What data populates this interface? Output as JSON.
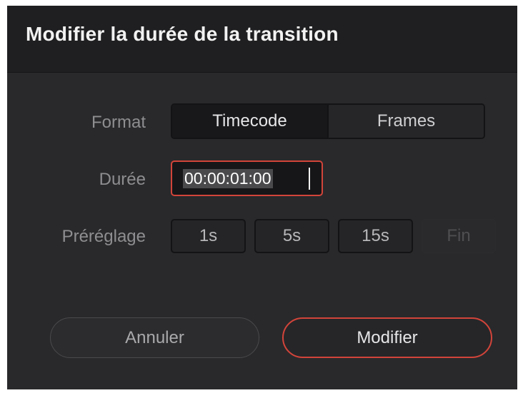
{
  "dialog": {
    "title": "Modifier la durée de la transition"
  },
  "format": {
    "label": "Format",
    "options": [
      "Timecode",
      "Frames"
    ],
    "selected": "Timecode"
  },
  "duration": {
    "label": "Durée",
    "value": "00:00:01:00"
  },
  "presets": {
    "label": "Préréglage",
    "items": [
      {
        "label": "1s",
        "enabled": true
      },
      {
        "label": "5s",
        "enabled": true
      },
      {
        "label": "15s",
        "enabled": true
      },
      {
        "label": "Fin",
        "enabled": false
      }
    ]
  },
  "buttons": {
    "cancel_label": "Annuler",
    "modify_label": "Modifier"
  },
  "colors": {
    "accent": "#d2443a",
    "panel": "#29292b",
    "titlebar": "#1f1f21"
  }
}
